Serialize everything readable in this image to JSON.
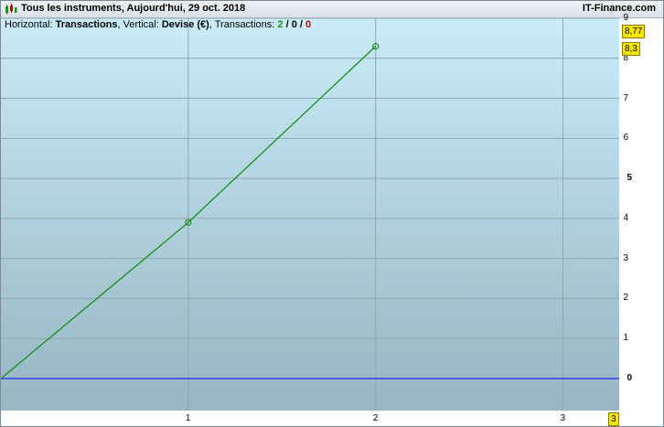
{
  "window": {
    "title": "Tous les instruments, Aujourd'hui, 29 oct. 2018",
    "brand": "IT-Finance.com"
  },
  "info": {
    "horizontal_label": "Horizontal:",
    "horizontal_value": "Transactions",
    "vertical_label": "Vertical:",
    "vertical_value": "Devise (€)",
    "transactions_label": "Transactions:",
    "winners": "2",
    "neutral": "0",
    "losers": "0",
    "sep1": " / ",
    "sep2": " / "
  },
  "badges": {
    "top_value": "8,77",
    "last_value": "8,3",
    "x_current": "3"
  },
  "colors": {
    "line": "#1a8f1a",
    "zero_line": "#0000ff",
    "badge": "#f7e600",
    "grid": "#8fa7b5",
    "plot_top": "#c9ecf8",
    "plot_bottom": "#97b5c2"
  },
  "chart_data": {
    "type": "line",
    "x": [
      0,
      1,
      2
    ],
    "series": [
      {
        "values": [
          0,
          3.9,
          8.3
        ]
      }
    ],
    "xlim": [
      0,
      3.3
    ],
    "ylim": [
      -0.8,
      9
    ],
    "xticks": [
      "1",
      "2",
      "3"
    ],
    "yticks": [
      "0",
      "1",
      "2",
      "3",
      "4",
      "5",
      "6",
      "7",
      "8",
      "9"
    ],
    "grid": true
  }
}
